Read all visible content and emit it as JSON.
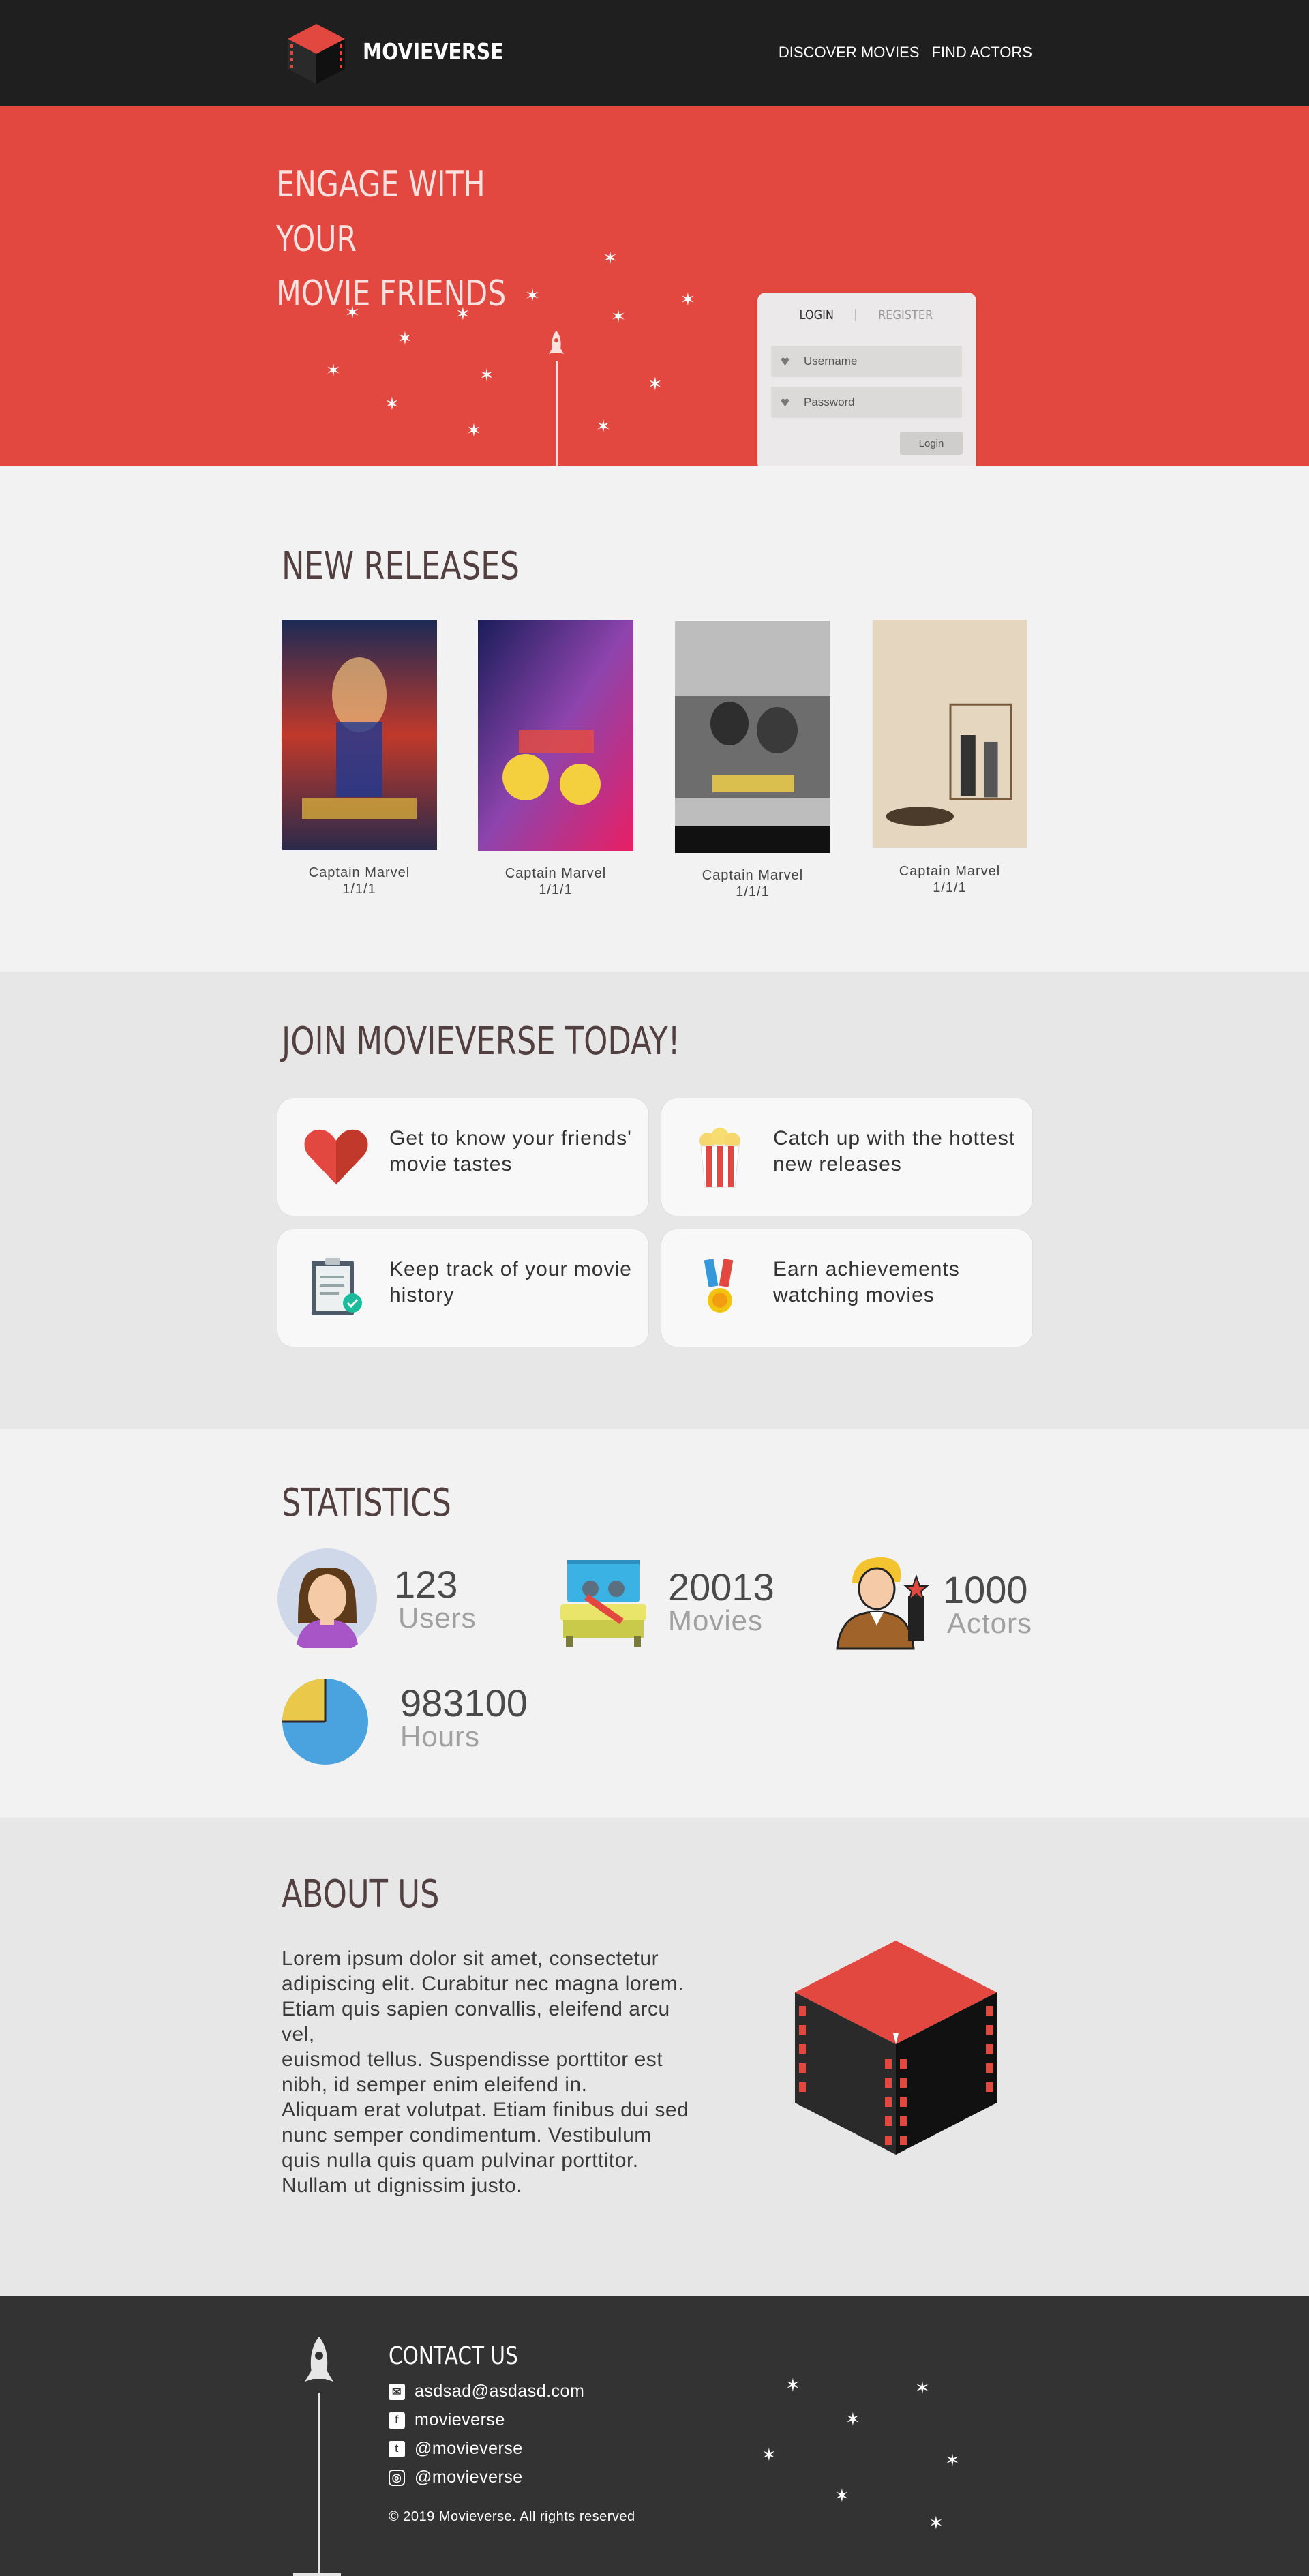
{
  "nav": {
    "brand": "MOVIEVERSE",
    "links": [
      "DISCOVER MOVIES",
      "FIND ACTORS"
    ]
  },
  "hero": {
    "headline_1": "ENGAGE WITH YOUR",
    "headline_2": "MOVIE FRIENDS",
    "login": {
      "tab_login": "LOGIN",
      "tab_register": "REGISTER",
      "username_placeholder": "Username",
      "password_placeholder": "Password",
      "button": "Login"
    }
  },
  "new_releases": {
    "title": "NEW RELEASES",
    "movies": [
      {
        "title": "Captain Marvel",
        "date": "1/1/1"
      },
      {
        "title": "Captain Marvel",
        "date": "1/1/1"
      },
      {
        "title": "Captain Marvel",
        "date": "1/1/1"
      },
      {
        "title": "Captain Marvel",
        "date": "1/1/1"
      }
    ]
  },
  "join": {
    "title": "JOIN MOVIEVERSE TODAY!",
    "features": [
      {
        "icon": "heart-icon",
        "text": "Get to know your friends' movie tastes"
      },
      {
        "icon": "popcorn-icon",
        "text": "Catch up with the hottest new releases"
      },
      {
        "icon": "clipboard-check-icon",
        "text": "Keep track of your movie history"
      },
      {
        "icon": "medal-icon",
        "text": "Earn achievements watching movies"
      }
    ]
  },
  "statistics": {
    "title": "STATISTICS",
    "items": [
      {
        "icon": "user-avatar-icon",
        "value": "123",
        "label": "Users"
      },
      {
        "icon": "cinema-seat-icon",
        "value": "20013",
        "label": "Movies"
      },
      {
        "icon": "actor-icon",
        "value": "1000",
        "label": "Actors"
      },
      {
        "icon": "pie-clock-icon",
        "value": "983100",
        "label": "Hours"
      }
    ]
  },
  "about": {
    "title": "ABOUT US",
    "text": "Lorem ipsum dolor sit amet, consectetur\nadipiscing elit. Curabitur nec magna lorem.\nEtiam quis sapien convallis, eleifend arcu\nvel,\neuismod tellus. Suspendisse porttitor est\nnibh, id semper enim eleifend in.\nAliquam erat volutpat. Etiam finibus dui sed\nnunc semper condimentum. Vestibulum\nquis nulla quis quam pulvinar porttitor.\nNullam ut dignissim justo."
  },
  "footer": {
    "title": "CONTACT US",
    "email": "asdsad@asdasd.com",
    "facebook": "movieverse",
    "twitter": "@movieverse",
    "instagram": "@movieverse",
    "copyright": "© 2019 Movieverse. All rights reserved"
  },
  "colors": {
    "nav_bg": "#1f1f1f",
    "hero_red": "#e34840",
    "footer_bg": "#333333",
    "title_brown": "#523f3f"
  }
}
